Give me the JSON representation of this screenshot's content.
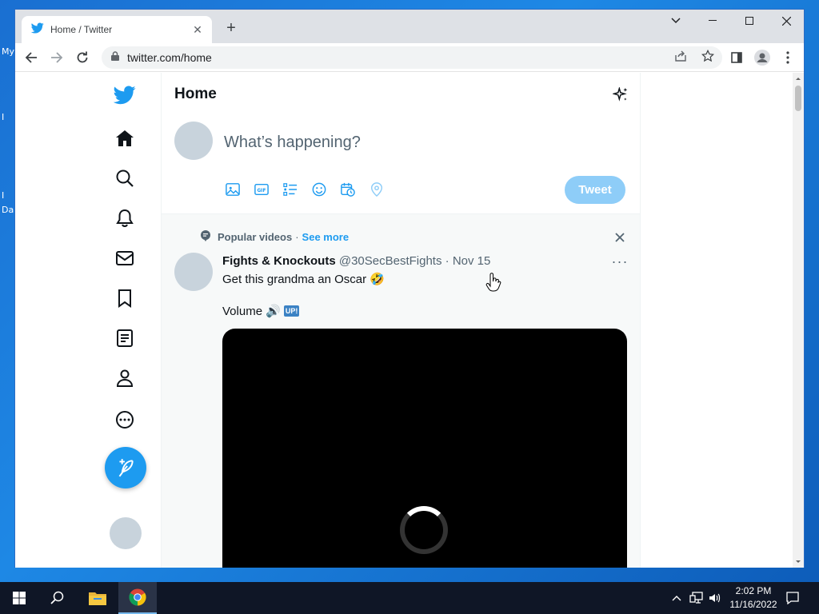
{
  "desktop": {
    "labels": [
      "My",
      "I",
      "I",
      "Da"
    ]
  },
  "browser": {
    "tab_title": "Home / Twitter",
    "tab_close": "✕",
    "new_tab": "+",
    "url": "twitter.com/home"
  },
  "twitter": {
    "page_title": "Home",
    "compose_placeholder": "What’s happening?",
    "tweet_button": "Tweet",
    "popular": {
      "label": "Popular videos",
      "separator": "·",
      "see_more": "See more"
    },
    "tweet": {
      "name": "Fights & Knockouts",
      "handle": "@30SecBestFights",
      "separator": "·",
      "date": "Nov 15",
      "text": "Get this grandma an Oscar 🤣",
      "volume_text": "Volume 🔊",
      "up_badge": "UP!",
      "more": "···"
    }
  },
  "taskbar": {
    "time": "2:02 PM",
    "date": "11/16/2022"
  },
  "colors": {
    "twitter_blue": "#1d9bf0",
    "tweet_disabled": "#8ecdf8",
    "desktop_blue": "#1a6fd1",
    "taskbar": "#0f1626"
  }
}
